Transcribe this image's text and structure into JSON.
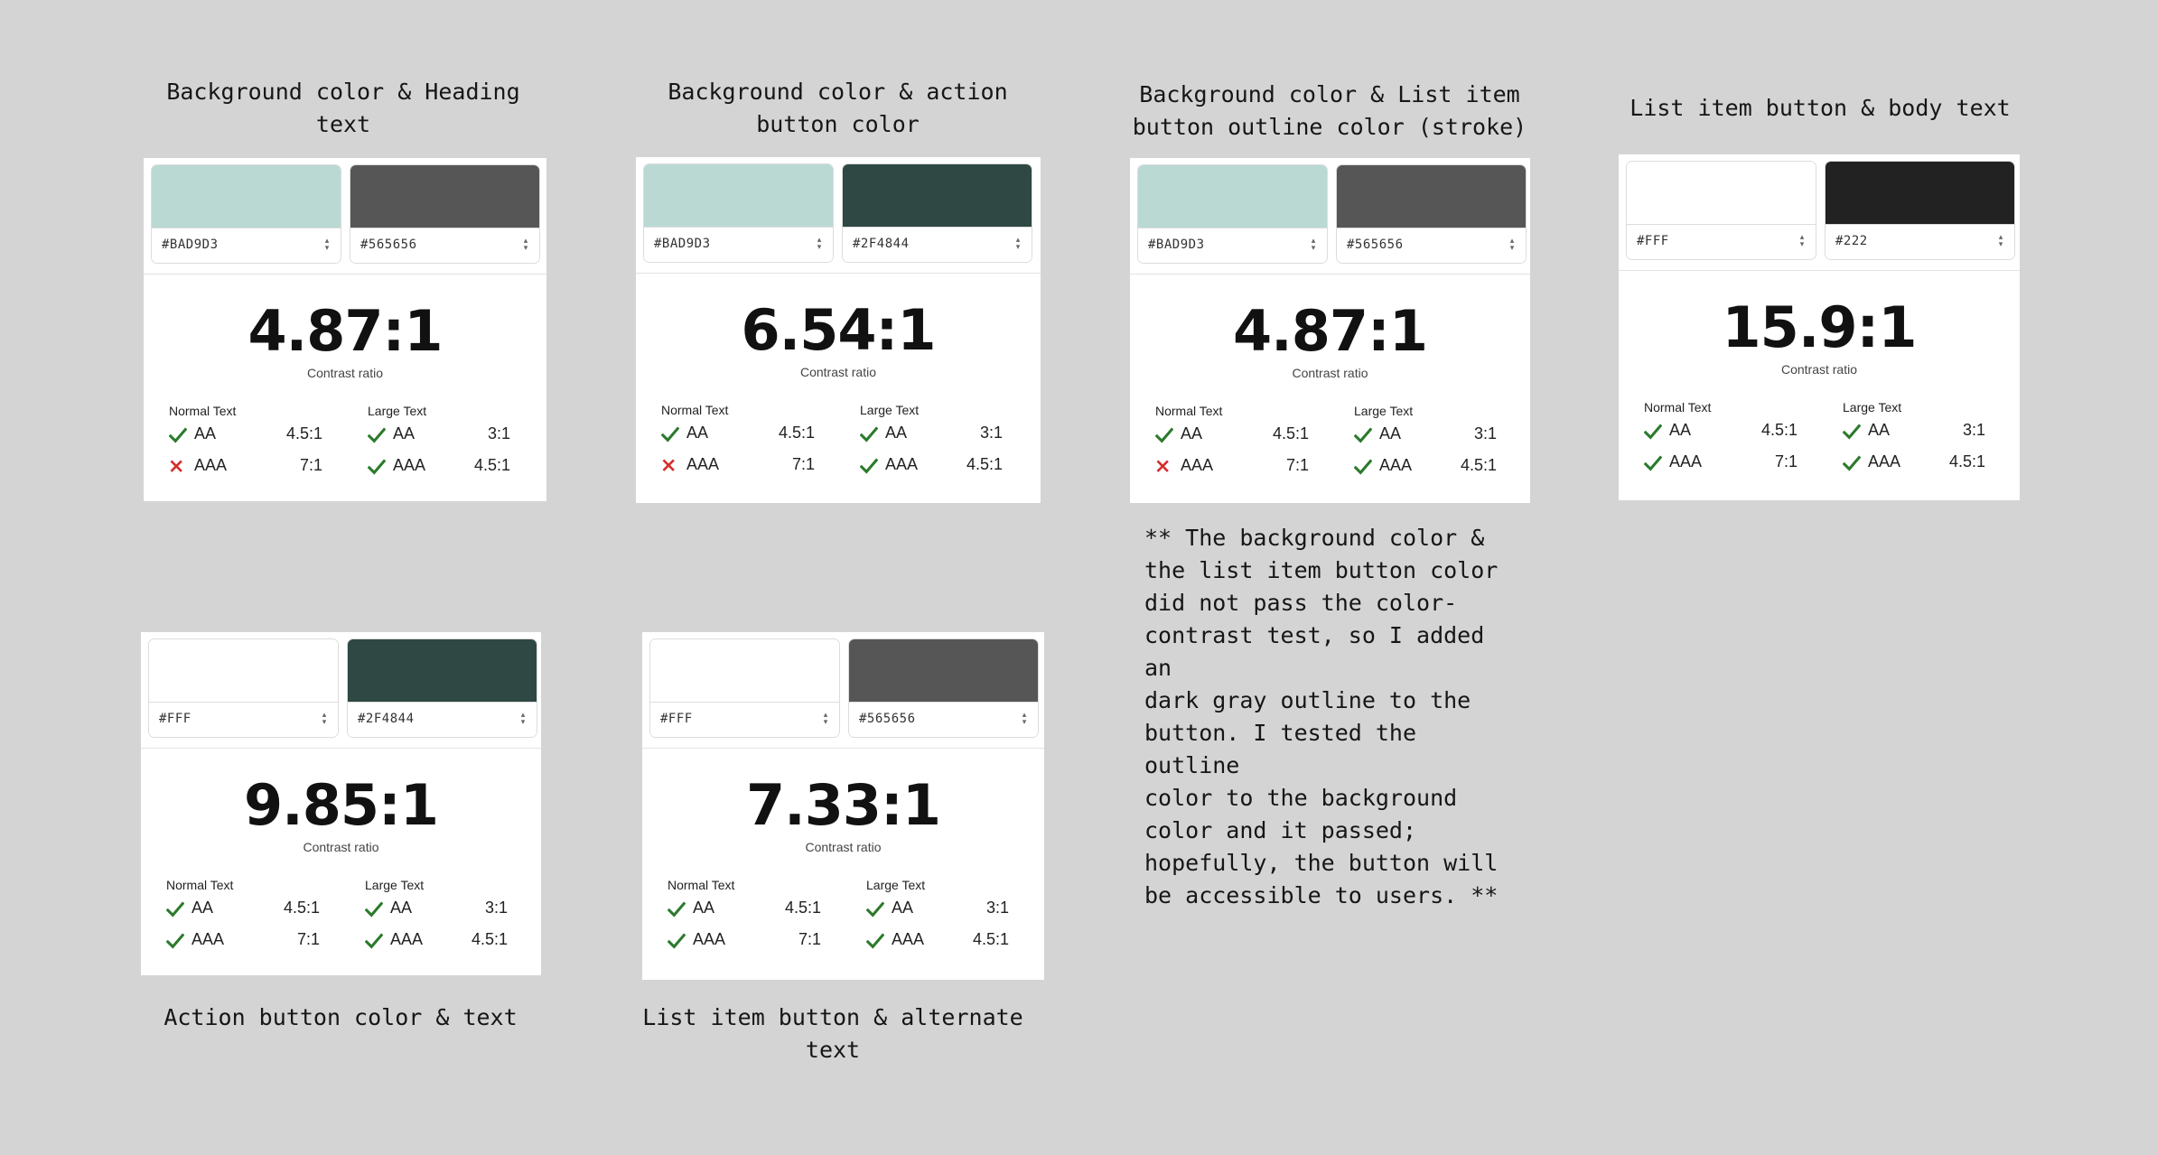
{
  "colors": {
    "background": "#d4d4d4",
    "pass": "#2b7a2b",
    "fail": "#d62d2d"
  },
  "captions": {
    "c1": "Background color & Heading\ntext",
    "c2": "Background color & action\nbutton color",
    "c3": "Background color & List item\nbutton outline color (stroke)",
    "c4": "List item button & body text",
    "c5": "Action button color & text",
    "c6": "List item button & alternate\ntext"
  },
  "note": "** The background color &\nthe list item button color\ndid not pass the color-\ncontrast test, so I added an\ndark gray outline to the\nbutton. I tested the outline\ncolor to the background\ncolor and it passed;\nhopefully, the button will\nbe accessible to users. **",
  "labels": {
    "contrast_ratio": "Contrast ratio",
    "normal_text": "Normal Text",
    "large_text": "Large Text",
    "aa": "AA",
    "aaa": "AAA",
    "req_normal_aa": "4.5:1",
    "req_normal_aaa": "7:1",
    "req_large_aa": "3:1",
    "req_large_aaa": "4.5:1"
  },
  "cards": [
    {
      "fg_hex": "#BAD9D3",
      "fg_color": "#bad9d3",
      "bg_hex": "#565656",
      "bg_color": "#565656",
      "ratio": "4.87:1",
      "normal_aa": "pass",
      "normal_aaa": "fail",
      "large_aa": "pass",
      "large_aaa": "pass"
    },
    {
      "fg_hex": "#BAD9D3",
      "fg_color": "#bad9d3",
      "bg_hex": "#2F4844",
      "bg_color": "#2f4844",
      "ratio": "6.54:1",
      "normal_aa": "pass",
      "normal_aaa": "fail",
      "large_aa": "pass",
      "large_aaa": "pass"
    },
    {
      "fg_hex": "#BAD9D3",
      "fg_color": "#bad9d3",
      "bg_hex": "#565656",
      "bg_color": "#565656",
      "ratio": "4.87:1",
      "normal_aa": "pass",
      "normal_aaa": "fail",
      "large_aa": "pass",
      "large_aaa": "pass"
    },
    {
      "fg_hex": "#FFF",
      "fg_color": "#ffffff",
      "bg_hex": "#222",
      "bg_color": "#222222",
      "ratio": "15.9:1",
      "normal_aa": "pass",
      "normal_aaa": "pass",
      "large_aa": "pass",
      "large_aaa": "pass"
    },
    {
      "fg_hex": "#FFF",
      "fg_color": "#ffffff",
      "bg_hex": "#2F4844",
      "bg_color": "#2f4844",
      "ratio": "9.85:1",
      "normal_aa": "pass",
      "normal_aaa": "pass",
      "large_aa": "pass",
      "large_aaa": "pass"
    },
    {
      "fg_hex": "#FFF",
      "fg_color": "#ffffff",
      "bg_hex": "#565656",
      "bg_color": "#565656",
      "ratio": "7.33:1",
      "normal_aa": "pass",
      "normal_aaa": "pass",
      "large_aa": "pass",
      "large_aaa": "pass"
    }
  ]
}
